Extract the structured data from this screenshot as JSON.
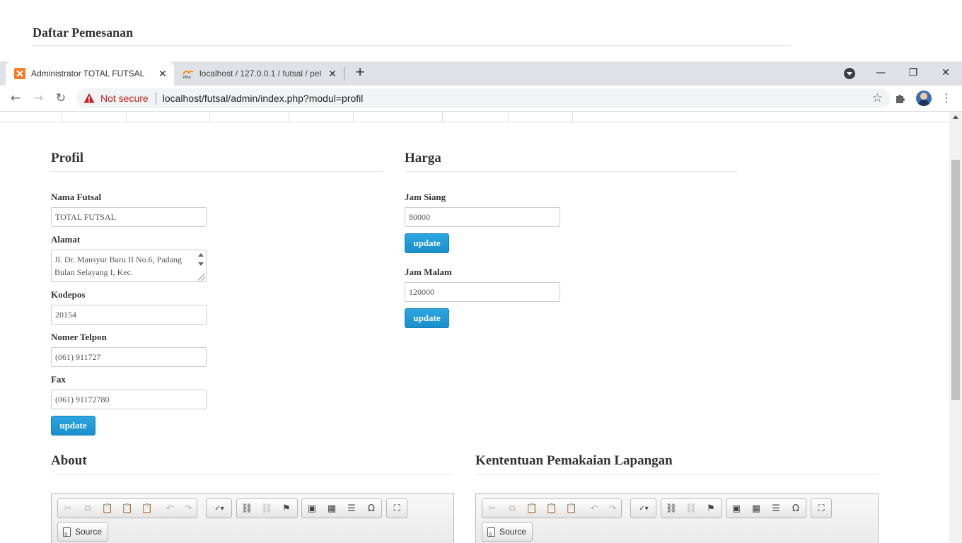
{
  "background_page": {
    "title": "Daftar Pemesanan"
  },
  "browser": {
    "tabs": [
      {
        "title": "Administrator TOTAL FUTSAL",
        "icon": "xampp-icon",
        "active": true
      },
      {
        "title": "localhost / 127.0.0.1 / futsal / pel",
        "icon": "phpmyadmin-icon",
        "active": false
      }
    ],
    "new_tab": "+",
    "not_secure": "Not secure",
    "url": "localhost/futsal/admin/index.php?modul=profil",
    "window_controls": {
      "minimize": "—",
      "restore": "❐",
      "close": "✕"
    }
  },
  "profil": {
    "heading": "Profil",
    "fields": {
      "nama_label": "Nama Futsal",
      "nama_value": "TOTAL FUTSAL",
      "alamat_label": "Alamat",
      "alamat_value": "Jl. Dr. Mansyur Baru II No.6, Padang Bulan Selayang I, Kec.",
      "kodepos_label": "Kodepos",
      "kodepos_value": "20154",
      "telpon_label": "Nomer Telpon",
      "telpon_value": "(061) 911727",
      "fax_label": "Fax",
      "fax_value": "(061) 91172780"
    },
    "update_label": "update"
  },
  "harga": {
    "heading": "Harga",
    "siang_label": "Jam Siang",
    "siang_value": "80000",
    "malam_label": "Jam Malam",
    "malam_value": "120000",
    "update_label": "update"
  },
  "about": {
    "heading": "About",
    "source_label": "Source"
  },
  "ketentuan": {
    "heading": "Kententuan Pemakaian Lapangan",
    "source_label": "Source"
  },
  "colors": {
    "accent": "#1a8fcc",
    "not_secure": "#c5221f",
    "tabstrip": "#dee1e6"
  }
}
